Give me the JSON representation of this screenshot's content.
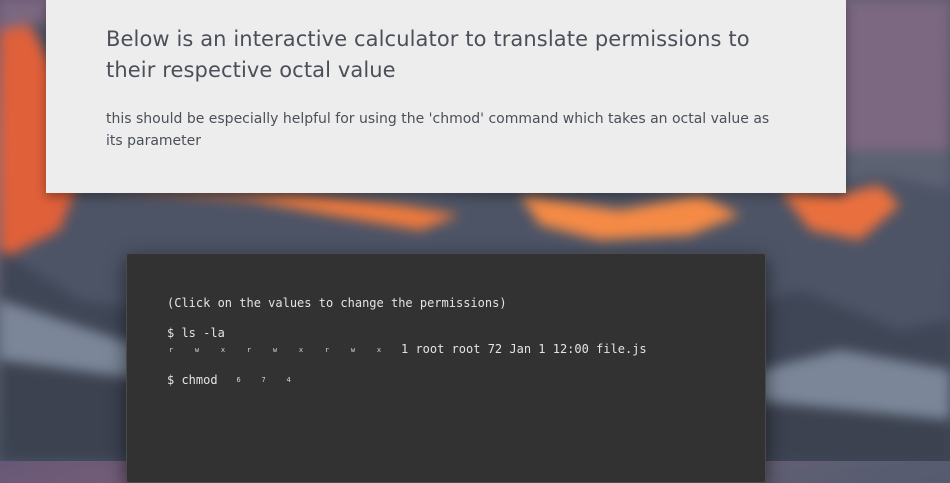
{
  "header": {
    "title": "Below is an interactive calculator to translate permissions to their respective octal value",
    "subtitle": "this should be especially helpful for using the 'chmod' command which takes an octal value as its parameter"
  },
  "terminal": {
    "hint": "(Click on the values to change the permissions)",
    "ls_command": "$ ls -la",
    "permissions": {
      "owner": [
        "r",
        "w",
        "x"
      ],
      "group": [
        "r",
        "w",
        "x"
      ],
      "others": [
        "r",
        "w",
        "x"
      ]
    },
    "file_info": "1 root root 72 Jan 1 12:00 file.js",
    "chmod_command": "$ chmod",
    "octal_values": [
      "6",
      "7",
      "4"
    ]
  }
}
